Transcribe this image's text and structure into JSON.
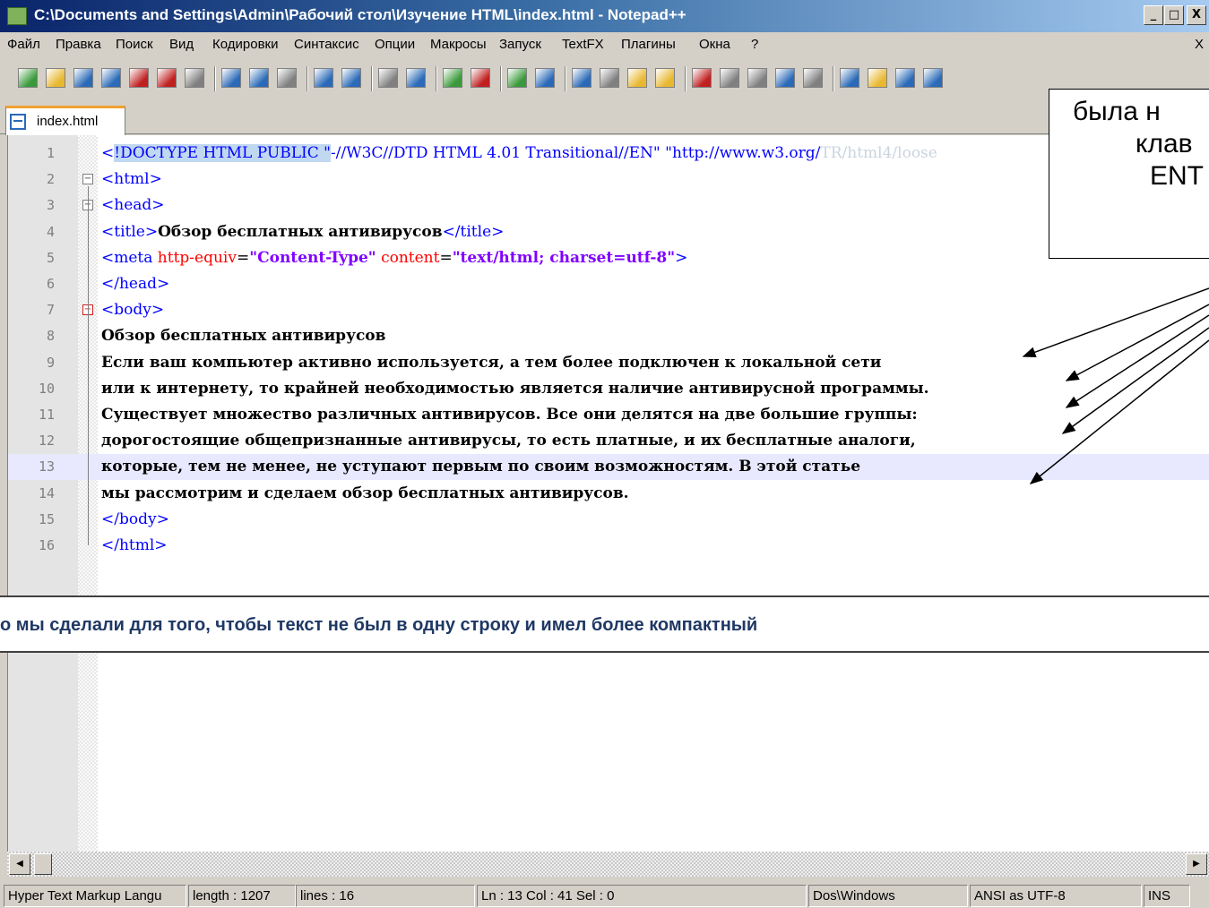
{
  "window": {
    "title": "C:\\Documents and Settings\\Admin\\Рабочий стол\\Изучение HTML\\index.html - Notepad++",
    "minimize_glyph": "_",
    "maximize_glyph": "□",
    "close_glyph": "X"
  },
  "menubar": {
    "items": [
      "Файл",
      "Правка",
      "Поиск",
      "Вид",
      "Кодировки",
      "Синтаксис",
      "Опции",
      "Макросы",
      "Запуск",
      "TextFX",
      "Плагины",
      "Окна",
      "?"
    ],
    "close_doc": "X"
  },
  "toolbar": {
    "icons": [
      "new-file-icon",
      "open-file-icon",
      "save-icon",
      "save-all-icon",
      "close-icon",
      "close-all-icon",
      "print-icon",
      "cut-icon",
      "copy-icon",
      "paste-icon",
      "undo-icon",
      "redo-icon",
      "find-icon",
      "replace-icon",
      "zoom-in-icon",
      "zoom-out-icon",
      "sync-vertical-icon",
      "sync-horizontal-icon",
      "word-wrap-icon",
      "show-all-chars-icon",
      "indent-guide-icon",
      "user-lang-icon",
      "record-macro-icon",
      "stop-record-icon",
      "play-macro-icon",
      "run-macro-multiple-icon",
      "save-macro-icon",
      "launch-icon",
      "open-in-browser-icon",
      "document-map-icon",
      "spellcheck-icon"
    ],
    "colors": {
      "green": "#3a9a3a",
      "blue": "#2a6ab8",
      "red": "#c02020",
      "yellow": "#e8b830",
      "gray": "#808080"
    }
  },
  "tab": {
    "label": "index.html"
  },
  "editor": {
    "lines": [
      {
        "num": "1",
        "fold": "",
        "parts": [
          {
            "cls": "tag",
            "t": "<"
          },
          {
            "cls": "tag hl",
            "t": "!DOCTYPE HTML PUBLIC \""
          },
          {
            "cls": "tag",
            "t": "-//W3C//DTD HTML 4.01 Transitional//EN"
          },
          {
            "cls": "tag",
            "t": "\" \""
          },
          {
            "cls": "tag",
            "t": "http://www.w3.org/"
          },
          {
            "cls": "faint",
            "t": "TR/html4/loose"
          }
        ]
      },
      {
        "num": "2",
        "fold": "⊟",
        "parts": [
          {
            "cls": "tag",
            "t": "<html>"
          }
        ]
      },
      {
        "num": "3",
        "fold": "⊟",
        "parts": [
          {
            "cls": "tag",
            "t": "<head>"
          }
        ]
      },
      {
        "num": "4",
        "fold": "",
        "parts": [
          {
            "cls": "tag",
            "t": "<title>"
          },
          {
            "cls": "txt",
            "t": "Обзор бесплатных антивирусов"
          },
          {
            "cls": "tag",
            "t": "</title>"
          }
        ]
      },
      {
        "num": "5",
        "fold": "",
        "parts": [
          {
            "cls": "tag",
            "t": "<meta "
          },
          {
            "cls": "attr",
            "t": "http-equiv"
          },
          {
            "cls": "",
            "t": "="
          },
          {
            "cls": "val",
            "t": "\"Content-Type\""
          },
          {
            "cls": "",
            "t": " "
          },
          {
            "cls": "attr",
            "t": "content"
          },
          {
            "cls": "",
            "t": "="
          },
          {
            "cls": "val",
            "t": "\"text/html; charset=utf-8\""
          },
          {
            "cls": "tag",
            "t": ">"
          }
        ]
      },
      {
        "num": "6",
        "fold": "",
        "parts": [
          {
            "cls": "tag",
            "t": "</head>"
          }
        ]
      },
      {
        "num": "7",
        "fold": "⊟",
        "parts": [
          {
            "cls": "tag",
            "t": "<body>"
          }
        ]
      },
      {
        "num": "8",
        "fold": "",
        "parts": [
          {
            "cls": "txt",
            "t": "Обзор бесплатных антивирусов"
          }
        ]
      },
      {
        "num": "9",
        "fold": "",
        "parts": [
          {
            "cls": "txt",
            "t": "Если ваш компьютер активно используется, а тем более подключен к локальной сети"
          }
        ]
      },
      {
        "num": "10",
        "fold": "",
        "parts": [
          {
            "cls": "txt",
            "t": "или к интернету, то крайней необходимостью является наличие антивирусной программы."
          }
        ]
      },
      {
        "num": "11",
        "fold": "",
        "parts": [
          {
            "cls": "txt",
            "t": "Существует множество различных антивирусов. Все они делятся на две большие группы:"
          }
        ]
      },
      {
        "num": "12",
        "fold": "",
        "parts": [
          {
            "cls": "txt",
            "t": "дорогостоящие общепризнанные антивирусы, то есть платные, и их бесплатные аналоги,"
          }
        ]
      },
      {
        "num": "13",
        "fold": "",
        "parts": [
          {
            "cls": "txt",
            "t": "которые, тем не менее, не уступают первым по своим возможностям. В этой статье"
          }
        ]
      },
      {
        "num": "14",
        "fold": "",
        "parts": [
          {
            "cls": "txt",
            "t": "мы рассмотрим и сделаем обзор бесплатных антивирусов."
          }
        ]
      },
      {
        "num": "15",
        "fold": "",
        "parts": [
          {
            "cls": "tag",
            "t": "</body>"
          }
        ]
      },
      {
        "num": "16",
        "fold": "",
        "parts": [
          {
            "cls": "tag",
            "t": "</html>"
          }
        ]
      }
    ],
    "current_line": "13"
  },
  "annotations": {
    "box_lines": [
      "была н",
      "клав",
      "ENT"
    ],
    "banner": "о мы сделали для того, чтобы текст не был в одну строку и имел более компактный"
  },
  "scrollbar": {
    "left_glyph": "◀",
    "right_glyph": "▶"
  },
  "statusbar": {
    "language": "Hyper Text Markup Langu",
    "length": "length : 1207",
    "lines": "lines : 16",
    "position": "Ln : 13    Col : 41    Sel : 0",
    "eol": "Dos\\Windows",
    "encoding": "ANSI as UTF-8",
    "mode": "INS"
  }
}
